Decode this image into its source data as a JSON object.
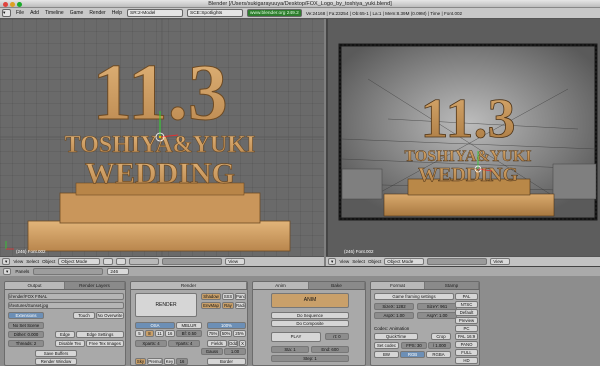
{
  "window": {
    "title": "Blender [/Users/sukigarayuuya/Desktop/FOX_Logo_by_toshiya_yuki.blend]"
  },
  "menubar": {
    "items": [
      "File",
      "Add",
      "Timeline",
      "Game",
      "Render",
      "Help"
    ],
    "screen_field": "SR:2-Model",
    "scene_field": "SCE:Spotlights",
    "website": "www.blender.org 249.2",
    "stats": "Ve:24168 | Fa:23254 | Ob:65-1 | La:1 | Mem:8.39M (0.09M) | Time | Font.002"
  },
  "scene": {
    "number_big": "11.3",
    "names": "TOSHIYA&YUKI",
    "wedding": "WEDDING"
  },
  "viewport_left": {
    "label": "(246) Font.002"
  },
  "viewport_right": {
    "label": "(246) Font.002"
  },
  "header_left": {
    "view": "View",
    "select": "Select",
    "object": "Object",
    "mode": "Object Mode",
    "pivot": "View"
  },
  "header_right": {
    "view": "View",
    "select": "Select",
    "object": "Object",
    "mode": "Object Mode",
    "pivot": "View"
  },
  "panels_bar": {
    "panels": "Panels",
    "frame": "246"
  },
  "output_panel": {
    "tabs": [
      "Output",
      "Render Layers"
    ],
    "paths": [
      "//render/FOX FINAL",
      "//textures/Sunset.jpg"
    ],
    "extensions": "Extensions",
    "touch": "Touch",
    "no_overwrite": "No Overwrite",
    "no_set_scene": "No Set Scene",
    "edge": "Edge",
    "edge_settings": "Edge Settings",
    "dither": "Dither: 0.000",
    "threads": "Threads: 2",
    "disable_tex": "Disable Tex",
    "free_tex_images": "Free Tex Images",
    "save_buffers": "Save Buffers",
    "render_window": "Render Window"
  },
  "render_panel": {
    "tabs": [
      "Render"
    ],
    "render": "RENDER",
    "shadow": "Shadow",
    "sss": "SSS",
    "pano": "Pano",
    "envmap": "EnvMap",
    "ray": "Ray",
    "radio": "Radio",
    "osa": "OSA",
    "mblur": "MBLUR",
    "percent": "100%",
    "osa_values": [
      "5",
      "8",
      "11",
      "16"
    ],
    "bf": "Bf: 0.50",
    "percents": [
      "75%",
      "50%",
      "25%"
    ],
    "xparts": "Xparts: 4",
    "yparts": "Yparts: 4",
    "fields": "Fields",
    "odd": "Odd",
    "x": "X",
    "gauss": "Gauss",
    "gauss_val": "1.00",
    "sky": "Sky",
    "premul": "Premul",
    "key": "Key",
    "border": "Border",
    "bits": "16"
  },
  "anim_panel": {
    "tabs": [
      "Anim",
      "Bake"
    ],
    "anim": "ANIM",
    "do_sequence": "Do Sequence",
    "do_composite": "Do Composite",
    "play": "PLAY",
    "rt": "rt: 0",
    "sta": "Sta: 1",
    "end": "End: 600",
    "step": "Step: 1"
  },
  "format_panel": {
    "tabs": [
      "Format",
      "Stamp"
    ],
    "preset": "Game framing settings",
    "sizex": "SizeX: 1282",
    "sizey": "SizeY: 961",
    "aspx": "AspX: 1.00",
    "aspy": "AspY: 1.00",
    "codec": "Codec: Animation",
    "quicktime": "QuickTime",
    "crop": "Crop",
    "set_codec": "Set codec",
    "fps": "FPS: 30",
    "fps2": "/ 1.000",
    "bw": "BW",
    "rgb": "RGB",
    "rgba": "RGBA",
    "presets": [
      "PAL",
      "NTSC",
      "Default",
      "Preview",
      "PC",
      "PAL 16:9",
      "PANO",
      "FULL",
      "HD"
    ]
  },
  "colors": {
    "accent": "#c9a06a",
    "viewport": "#6a6a6a",
    "panel": "#a9a9a9",
    "logo": "#d3a56b"
  }
}
